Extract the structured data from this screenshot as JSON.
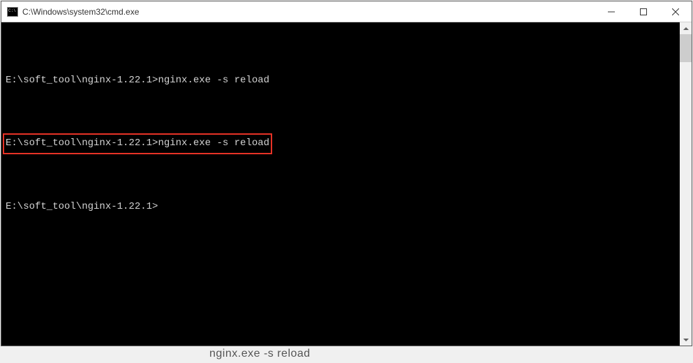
{
  "titlebar": {
    "title": "C:\\Windows\\system32\\cmd.exe",
    "minimize_label": "Minimize",
    "maximize_label": "Maximize",
    "close_label": "Close"
  },
  "terminal": {
    "lines": [
      {
        "prompt": "E:\\soft_tool\\nginx-1.22.1>",
        "command": "nginx.exe -s reload",
        "highlighted": false
      },
      {
        "prompt": "E:\\soft_tool\\nginx-1.22.1>",
        "command": "nginx.exe -s reload",
        "highlighted": true
      },
      {
        "prompt": "E:\\soft_tool\\nginx-1.22.1>",
        "command": "",
        "highlighted": false
      }
    ]
  },
  "below_text": "nginx.exe    -s reload"
}
